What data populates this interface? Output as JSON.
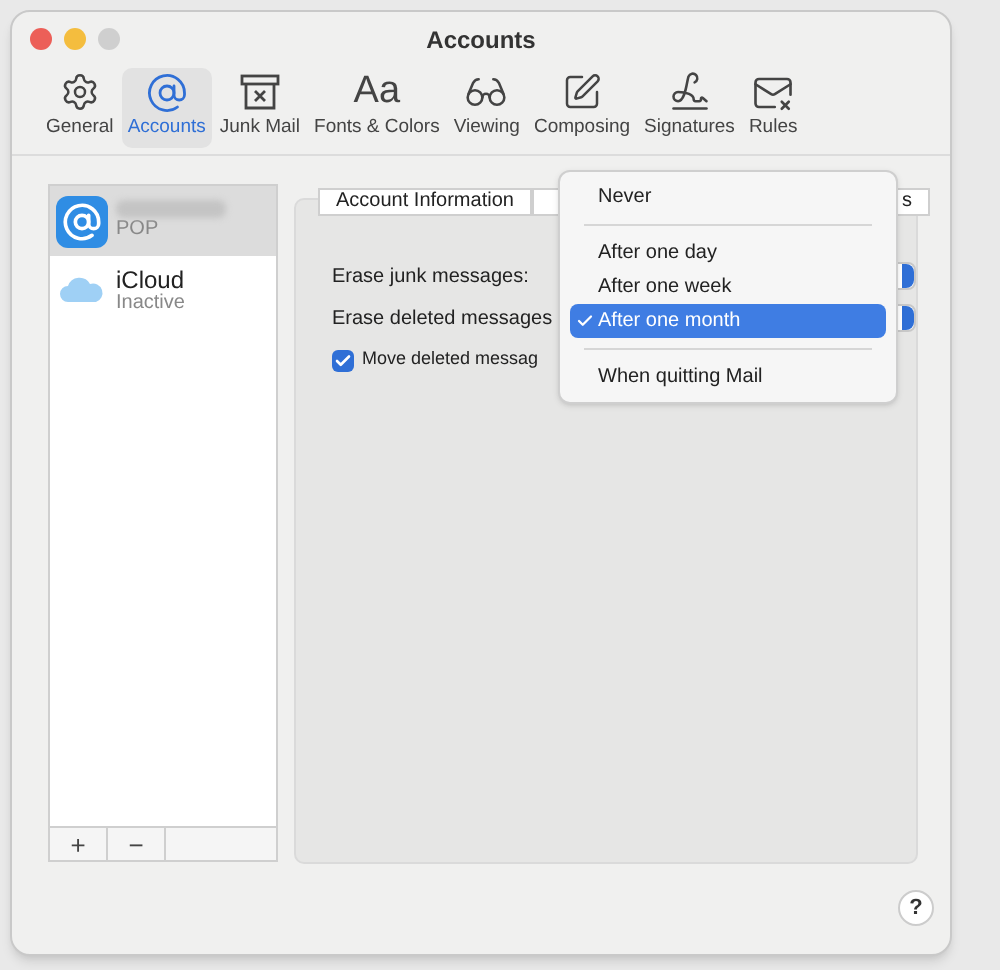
{
  "window": {
    "title": "Accounts"
  },
  "toolbar": [
    {
      "label": "General",
      "selected": false
    },
    {
      "label": "Accounts",
      "selected": true
    },
    {
      "label": "Junk Mail",
      "selected": false
    },
    {
      "glyph": "Aa",
      "label": "Fonts & Colors",
      "selected": false
    },
    {
      "label": "Viewing",
      "selected": false
    },
    {
      "label": "Composing",
      "selected": false
    },
    {
      "label": "Signatures",
      "selected": false
    },
    {
      "label": "Rules",
      "selected": false
    }
  ],
  "accounts": [
    {
      "status": "POP",
      "selected": true
    },
    {
      "name": "iCloud",
      "status": "Inactive",
      "selected": false
    }
  ],
  "sidebar_buttons": [
    "+",
    "−"
  ],
  "tabs": [
    {
      "label": "Account Information",
      "selected": false
    },
    {
      "selected": false
    },
    {
      "label": "s",
      "selected": false
    }
  ],
  "settings": [
    {
      "kind": "popup",
      "label": "Erase junk messages:"
    },
    {
      "kind": "popup",
      "label": "Erase deleted messages"
    },
    {
      "kind": "checkbox",
      "label": "Move deleted messag",
      "checked": true
    }
  ],
  "menu": [
    {
      "kind": "item",
      "label": "Never",
      "selected": false
    },
    {
      "kind": "separator"
    },
    {
      "kind": "item",
      "label": "After one day",
      "selected": false
    },
    {
      "kind": "item",
      "label": "After one week",
      "selected": false
    },
    {
      "kind": "item",
      "label": "After one month",
      "selected": true
    },
    {
      "kind": "separator"
    },
    {
      "kind": "item",
      "label": "When quitting Mail",
      "selected": false
    }
  ],
  "help": "?"
}
